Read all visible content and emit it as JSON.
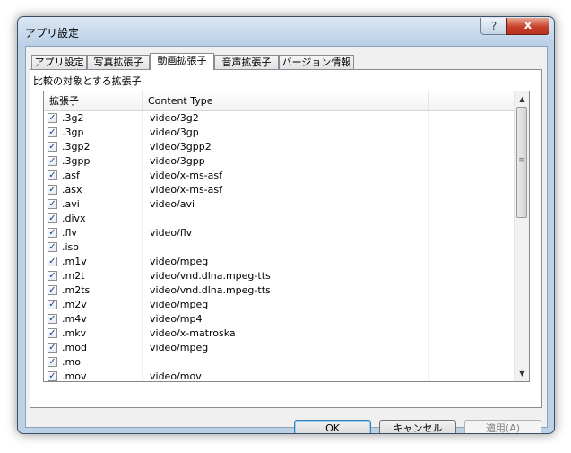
{
  "window": {
    "title": "アプリ設定"
  },
  "titlebar": {
    "help_glyph": "?",
    "close_glyph": "x"
  },
  "tabs": [
    {
      "label": "アプリ設定"
    },
    {
      "label": "写真拡張子"
    },
    {
      "label": "動画拡張子"
    },
    {
      "label": "音声拡張子"
    },
    {
      "label": "バージョン情報"
    }
  ],
  "panel": {
    "caption": "比較の対象とする拡張子",
    "columns": [
      "拡張子",
      "Content Type"
    ],
    "rows": [
      {
        "ext": ".3g2",
        "type": "video/3g2"
      },
      {
        "ext": ".3gp",
        "type": "video/3gp"
      },
      {
        "ext": ".3gp2",
        "type": "video/3gpp2"
      },
      {
        "ext": ".3gpp",
        "type": "video/3gpp"
      },
      {
        "ext": ".asf",
        "type": "video/x-ms-asf"
      },
      {
        "ext": ".asx",
        "type": "video/x-ms-asf"
      },
      {
        "ext": ".avi",
        "type": "video/avi"
      },
      {
        "ext": ".divx",
        "type": ""
      },
      {
        "ext": ".flv",
        "type": "video/flv"
      },
      {
        "ext": ".iso",
        "type": ""
      },
      {
        "ext": ".m1v",
        "type": "video/mpeg"
      },
      {
        "ext": ".m2t",
        "type": "video/vnd.dlna.mpeg-tts"
      },
      {
        "ext": ".m2ts",
        "type": "video/vnd.dlna.mpeg-tts"
      },
      {
        "ext": ".m2v",
        "type": "video/mpeg"
      },
      {
        "ext": ".m4v",
        "type": "video/mp4"
      },
      {
        "ext": ".mkv",
        "type": "video/x-matroska"
      },
      {
        "ext": ".mod",
        "type": "video/mpeg"
      },
      {
        "ext": ".moi",
        "type": ""
      },
      {
        "ext": ".mov",
        "type": "video/mov"
      }
    ],
    "checkbox_icon": "checkmark-icon",
    "checkbox_glyph": "✓"
  },
  "scrollbar": {
    "up_glyph": "▲",
    "down_glyph": "▼",
    "grip_glyph": "≡"
  },
  "buttons": {
    "ok": "OK",
    "cancel": "キャンセル",
    "apply": "適用(A)"
  },
  "colors": {
    "accent": "#3c7fb1",
    "close": "#c7422a",
    "frame": "#bcd0e6"
  }
}
